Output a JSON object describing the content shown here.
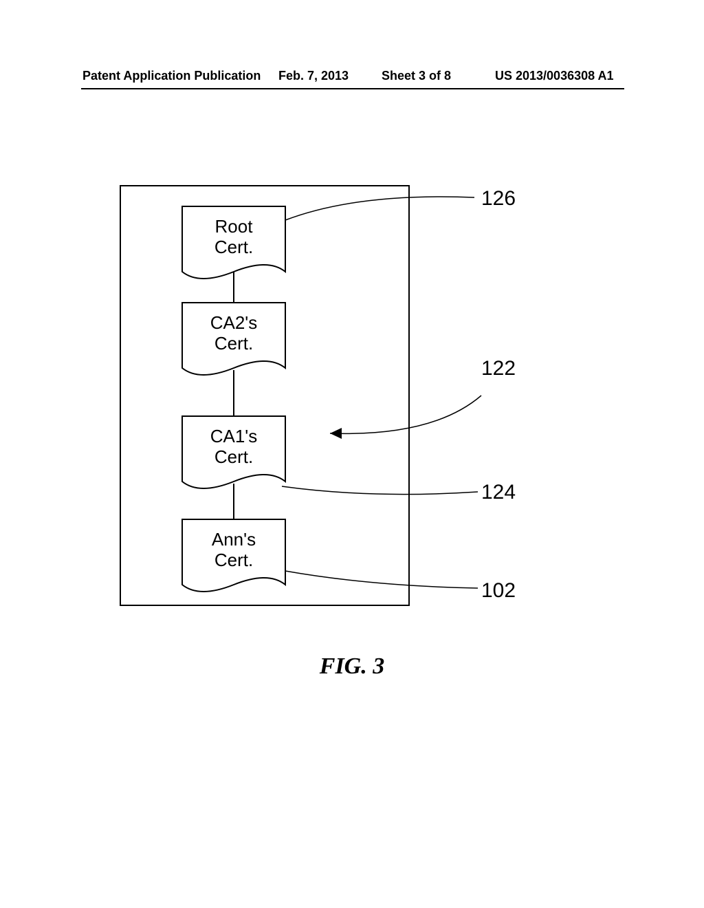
{
  "header": {
    "pub_label": "Patent Application Publication",
    "date": "Feb. 7, 2013",
    "sheet": "Sheet 3 of 8",
    "pub_no": "US 2013/0036308 A1"
  },
  "figure_caption": "FIG. 3",
  "diagram": {
    "certs": {
      "root": {
        "line1": "Root",
        "line2": "Cert."
      },
      "ca2": {
        "line1": "CA2's",
        "line2": "Cert."
      },
      "ca1": {
        "line1": "CA1's",
        "line2": "Cert."
      },
      "ann": {
        "line1": "Ann's",
        "line2": "Cert."
      }
    },
    "refs": {
      "root_ref": "126",
      "box_ref": "122",
      "ca1_ref": "124",
      "ann_ref": "102"
    }
  }
}
